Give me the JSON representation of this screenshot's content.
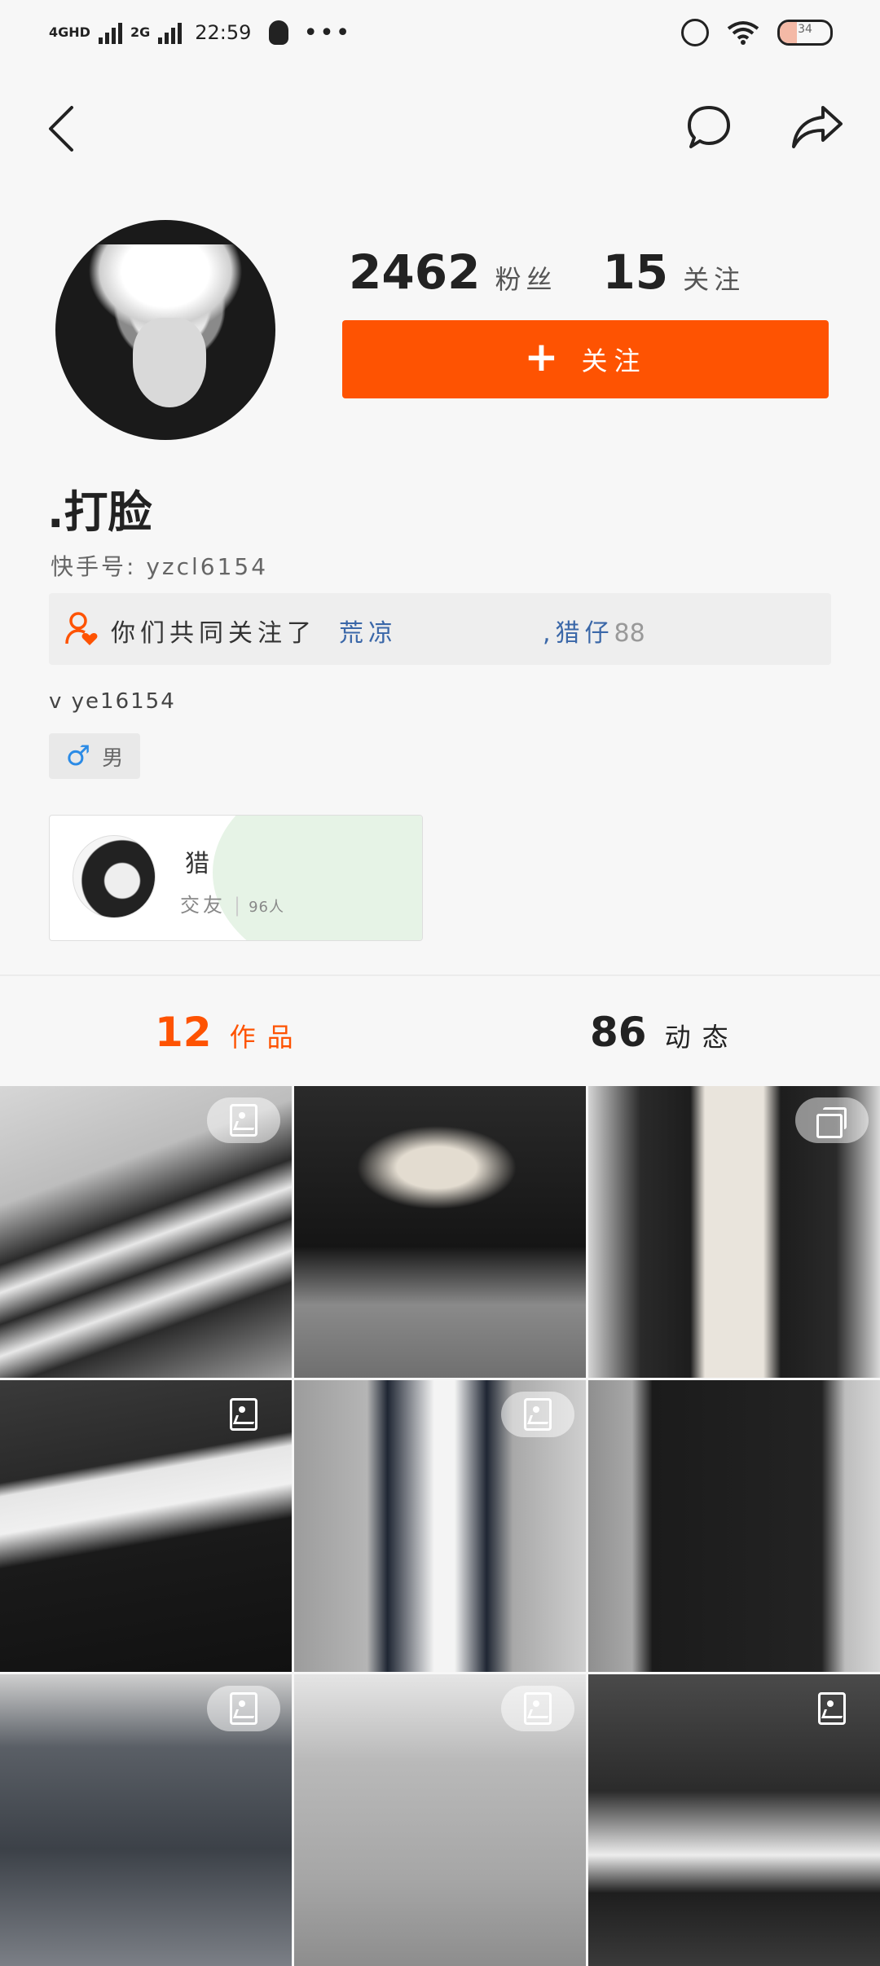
{
  "status_bar": {
    "network1": "4GHD",
    "network2": "2G",
    "time": "22:59",
    "more": "•••",
    "battery_level": "34",
    "battery_fraction": 0.34,
    "icons": [
      "signal-icon",
      "qq-penguin-icon",
      "alarm-icon",
      "wifi-icon",
      "battery-icon"
    ]
  },
  "nav": {
    "icons": [
      "back-arrow-icon",
      "message-bubble-icon",
      "share-arrow-icon"
    ]
  },
  "profile": {
    "fans_count": "2462",
    "fans_label": "粉丝",
    "following_count": "15",
    "following_label": "关注",
    "follow_button_label": "关注",
    "name": ".打脸",
    "kuaishou_id": "快手号: yzcl6154",
    "bio": "v ye16154",
    "gender": "男"
  },
  "mutual": {
    "prefix": "你们共同关注了",
    "name1": "荒凉",
    "name2": ",猎仔",
    "name2_deco": "88"
  },
  "group": {
    "name": "猎",
    "type": "交友",
    "count": "96人"
  },
  "tabs": [
    {
      "count": "12",
      "label": "作品",
      "active": true
    },
    {
      "count": "86",
      "label": "动态",
      "active": false
    }
  ],
  "colors": {
    "accent": "#fe5302",
    "link": "#3a67a8",
    "male": "#2b8be6"
  },
  "grid_items": [
    {
      "badge": "photo-icon"
    },
    {
      "badge": "none"
    },
    {
      "badge": "multi-photo-icon"
    },
    {
      "badge": "photo-icon"
    },
    {
      "badge": "photo-icon"
    },
    {
      "badge": "none"
    },
    {
      "badge": "photo-icon"
    },
    {
      "badge": "photo-icon"
    },
    {
      "badge": "photo-icon"
    }
  ]
}
